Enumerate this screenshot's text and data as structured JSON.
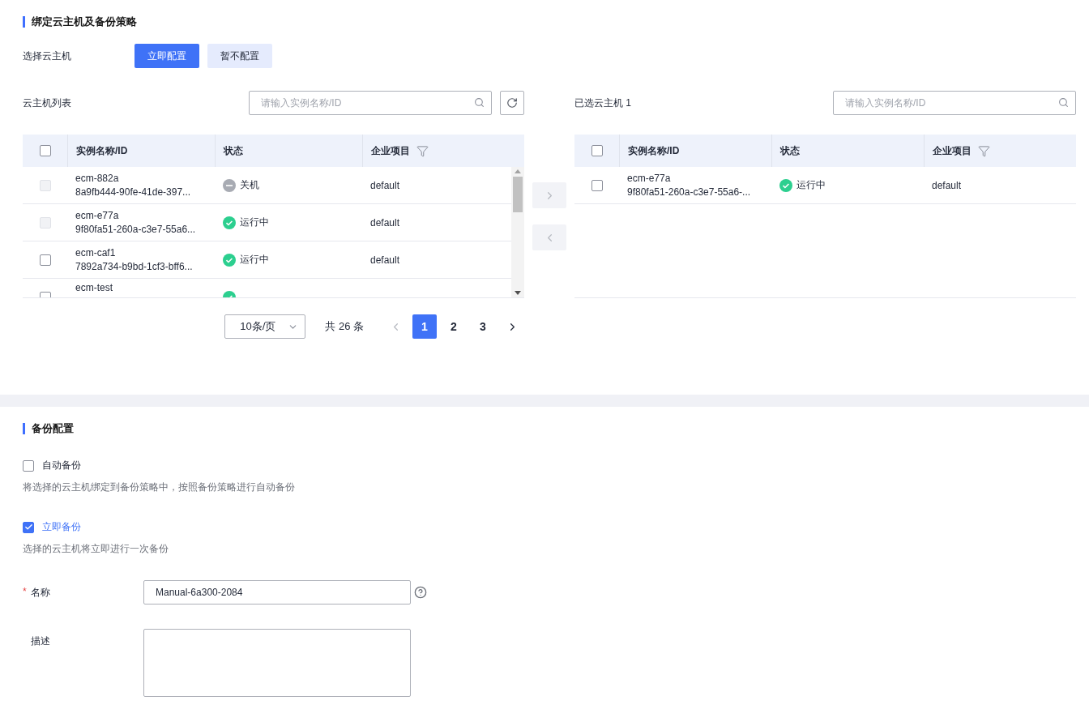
{
  "bind_section": {
    "title": "绑定云主机及备份策略",
    "select_label": "选择云主机",
    "buttons": [
      {
        "label": "立即配置",
        "selected": true
      },
      {
        "label": "暂不配置",
        "selected": false
      }
    ],
    "available": {
      "title": "云主机列表",
      "search": {
        "placeholder": "请输入实例名称/ID"
      },
      "columns": [
        "实例名称/ID",
        "状态",
        "企业项目"
      ],
      "header_checked": false,
      "rows": [
        {
          "name": "ecm-882a",
          "id": "8a9fb444-90fe-41de-397...",
          "status": {
            "kind": "stopped",
            "label": "关机"
          },
          "project": "default",
          "checked": false,
          "disabled": true
        },
        {
          "name": "ecm-e77a",
          "id": "9f80fa51-260a-c3e7-55a6...",
          "status": {
            "kind": "running",
            "label": "运行中"
          },
          "project": "default",
          "checked": false,
          "disabled": true
        },
        {
          "name": "ecm-caf1",
          "id": "7892a734-b9bd-1cf3-bff6...",
          "status": {
            "kind": "running",
            "label": "运行中"
          },
          "project": "default",
          "checked": false,
          "disabled": false
        },
        {
          "name": "ecm-test",
          "status": {
            "kind": "running"
          },
          "checked": false,
          "disabled": false
        }
      ],
      "pagination": {
        "page_size": "10条/页",
        "total": "共 26 条",
        "pages": [
          {
            "label": "1",
            "selected": true
          },
          {
            "label": "2",
            "selected": false
          },
          {
            "label": "3",
            "selected": false
          }
        ]
      }
    },
    "selected": {
      "title": "已选云主机 1",
      "search": {
        "placeholder": "请输入实例名称/ID"
      },
      "columns": [
        "实例名称/ID",
        "状态",
        "企业项目"
      ],
      "header_checked": false,
      "rows": [
        {
          "name": "ecm-e77a",
          "id": "9f80fa51-260a-c3e7-55a6-...",
          "status": {
            "kind": "running",
            "label": "运行中"
          },
          "project": "default",
          "checked": false,
          "disabled": false
        }
      ]
    }
  },
  "backup_section": {
    "title": "备份配置",
    "options": [
      {
        "label": "自动备份",
        "checked": false,
        "hint": "将选择的云主机绑定到备份策略中，按照备份策略进行自动备份"
      },
      {
        "label": "立即备份",
        "checked": true,
        "hint": "选择的云主机将立即进行一次备份"
      }
    ],
    "form": [
      {
        "kind": "input",
        "required_mark": "*",
        "label": "名称",
        "value": "Manual-6a300-2084",
        "help": true
      },
      {
        "kind": "textarea",
        "label": "描述"
      }
    ]
  }
}
